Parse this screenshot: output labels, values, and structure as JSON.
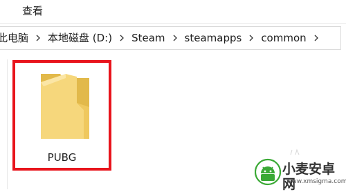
{
  "menubar": {
    "view_label": "查看"
  },
  "address_bar": {
    "crumbs": [
      "此电脑",
      "本地磁盘 (D:)",
      "Steam",
      "steamapps",
      "common"
    ]
  },
  "folders": [
    {
      "name": "PUBG",
      "highlighted": true,
      "icon": "folder-icon"
    }
  ],
  "watermark": {
    "brand": "小麦安卓网",
    "url": "www.xmsigma.com"
  },
  "colors": {
    "highlight_border": "#e8141c",
    "folder_yellow": "#f3cf6b",
    "watermark_green": "#3aa935"
  }
}
